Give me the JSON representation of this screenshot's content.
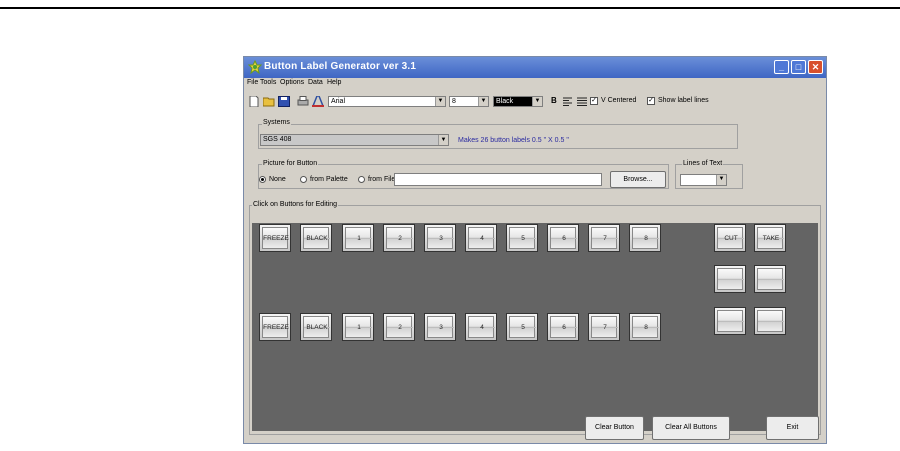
{
  "window": {
    "title": "Button Label Generator   ver 3.1"
  },
  "menu": [
    "File",
    "Tools",
    "Options",
    "Data",
    "Help"
  ],
  "toolbar": {
    "font": "Arial",
    "size": "8",
    "color": "Black",
    "bold_label": "B",
    "v_centered_label": "V Centered",
    "v_centered_checked": true,
    "show_lines_label": "Show label lines",
    "show_lines_checked": true
  },
  "systems": {
    "group_label": "Systems",
    "selected": "SGS 408",
    "info": "Makes 26 button labels 0.5 \" X 0.5 \""
  },
  "picture": {
    "group_label": "Picture for Button",
    "options": [
      "None",
      "from Palette",
      "from File:"
    ],
    "selected": "None",
    "file_value": "",
    "browse_label": "Browse..."
  },
  "lines_of_text": {
    "group_label": "Lines of Text",
    "value": ""
  },
  "editing": {
    "group_label": "Click on Buttons for Editing",
    "row1": [
      "FREEZE",
      "BLACK",
      "1",
      "2",
      "3",
      "4",
      "5",
      "6",
      "7",
      "8"
    ],
    "row2": [
      "FREEZE",
      "BLACK",
      "1",
      "2",
      "3",
      "4",
      "5",
      "6",
      "7",
      "8"
    ],
    "side": [
      "CUT",
      "TAKE",
      "",
      "",
      "",
      ""
    ]
  },
  "buttons": {
    "clear_button": "Clear Button",
    "clear_all": "Clear All Buttons",
    "exit": "Exit"
  },
  "colors": {
    "titlebar": "#3f66c4",
    "edit_area": "#646464",
    "window_bg": "#d4d0c8",
    "close": "#d8502c"
  }
}
